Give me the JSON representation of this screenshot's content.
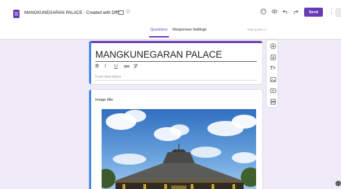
{
  "header": {
    "doc_title": "MANGKUNEGARAN PALACE - Created with Dffft",
    "send_label": "Send",
    "icons": [
      "folder-icon",
      "star-icon",
      "palette-icon",
      "eye-icon",
      "undo-icon",
      "redo-icon",
      "more-vert-icon"
    ]
  },
  "tabs": {
    "items": [
      {
        "label": "Questions"
      },
      {
        "label": "Responses"
      },
      {
        "label": "Settings"
      }
    ],
    "active": "Questions",
    "total_points": "Total points: 0"
  },
  "form": {
    "title": "MANGKUNEGARAN PALACE",
    "description_placeholder": "Form description",
    "format_buttons": [
      "B",
      "I",
      "U",
      "link",
      "clear-format"
    ]
  },
  "image_item": {
    "title": "Image title"
  },
  "side_toolbar": {
    "tools": [
      "add-question-icon",
      "import-questions-icon",
      "add-title-icon",
      "add-image-icon",
      "add-video-icon",
      "add-section-icon"
    ]
  },
  "colors": {
    "accent": "#673ab7",
    "background": "#f0ebf8",
    "focus_bar": "#4285f4"
  }
}
